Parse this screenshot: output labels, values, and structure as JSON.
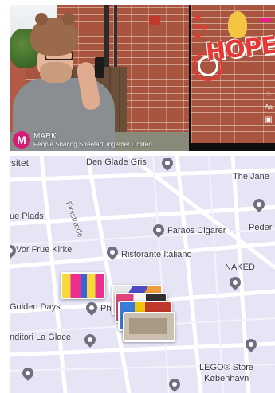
{
  "video": {
    "creator_initial": "M",
    "creator_name": "MARK",
    "creator_org": "People Sharing Streetart Together Limited",
    "ar_artwork_text": "HOPE",
    "side_icons": [
      "Aa"
    ]
  },
  "map": {
    "labels": {
      "rsitet": "rsitet",
      "den_glade_gris": "Den Glade Gris",
      "the_jane": "The Jane",
      "ue_plads": "ue Plads",
      "faraos_cigarer": "Faraos Cigarer",
      "peder": "Peder",
      "vor_frue_kirke": "Vor Frue Kirke",
      "ristorante_italiano": "Ristorante Italiano",
      "naked": "NAKED",
      "golden_days": "Golden Days",
      "ph": "Ph",
      "nditori_la_glace": "nditori La Glace",
      "lego_store": "LEGO® Store",
      "kobenhavn": "København",
      "street_fiolstraede": "Fiolstræde",
      "street_left": "rade"
    }
  }
}
